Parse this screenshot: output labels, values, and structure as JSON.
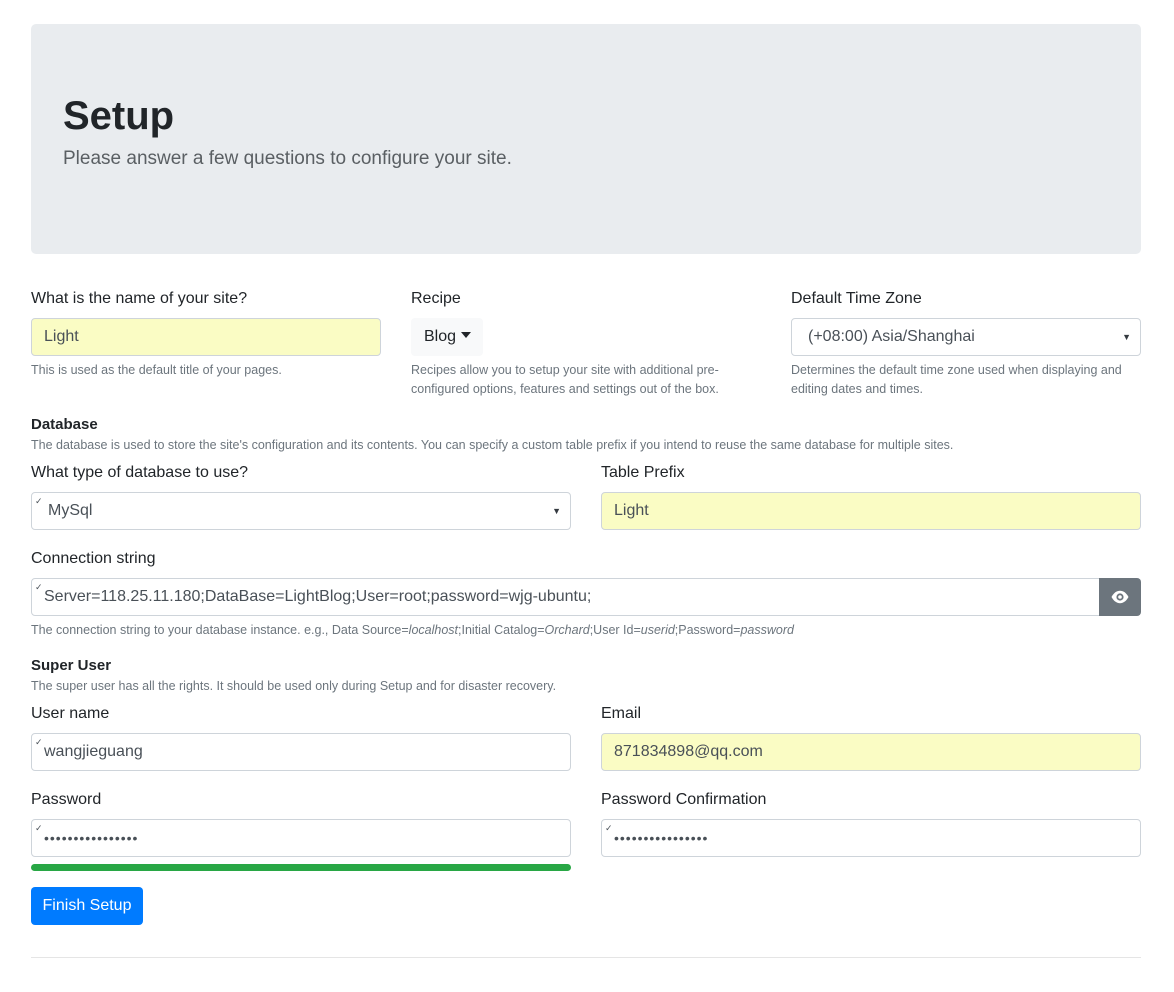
{
  "header": {
    "title": "Setup",
    "subtitle": "Please answer a few questions to configure your site."
  },
  "site": {
    "name_label": "What is the name of your site?",
    "name_value": "Light",
    "name_help": "This is used as the default title of your pages.",
    "recipe_label": "Recipe",
    "recipe_value": "Blog",
    "recipe_help_1": "Recipes allow you to setup your site with additional pre-",
    "recipe_help_2": "configured options, features and settings out of the box.",
    "timezone_label": "Default Time Zone",
    "timezone_value": "(+08:00) Asia/Shanghai",
    "timezone_help_1": "Determines the default time zone used when displaying and",
    "timezone_help_2": "editing dates and times."
  },
  "database": {
    "section_title": "Database",
    "section_help": "The database is used to store the site's configuration and its contents. You can specify a custom table prefix if you intend to reuse the same database for multiple sites.",
    "type_label": "What type of database to use?",
    "type_value": "MySql",
    "prefix_label": "Table Prefix",
    "prefix_value": "Light",
    "conn_label": "Connection string",
    "conn_value": "Server=118.25.11.180;DataBase=LightBlog;User=root;password=wjg-ubuntu;",
    "conn_help": {
      "prefix": "The connection string to your database instance. e.g., Data Source=",
      "source": "localhost",
      "catalog_label": ";Initial Catalog=",
      "catalog": "Orchard",
      "user_label": ";User Id=",
      "user": "userid",
      "pwd_label": ";Password=",
      "pwd": "password"
    }
  },
  "superuser": {
    "section_title": "Super User",
    "section_help": "The super user has all the rights. It should be used only during Setup and for disaster recovery.",
    "username_label": "User name",
    "username_value": "wangjieguang",
    "email_label": "Email",
    "email_value": "871834898@qq.com",
    "password_label": "Password",
    "password_value": "••••••••••••••••",
    "password_strength": 1.0,
    "confirm_label": "Password Confirmation",
    "confirm_value": "••••••••••••••••"
  },
  "actions": {
    "finish_label": "Finish Setup"
  },
  "icons": {
    "eye": "eye-icon",
    "dropdown": "chevron-down-icon",
    "autofill": "check-icon"
  },
  "colors": {
    "primary": "#007bff",
    "success": "#28a745",
    "secondary": "#6c757d",
    "autofill_bg": "#fafcc4",
    "jumbotron_bg": "#e9ecef"
  }
}
